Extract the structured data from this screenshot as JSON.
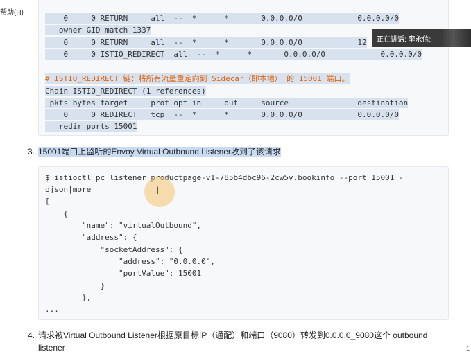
{
  "app": {
    "menu_help": "帮助(H)"
  },
  "speaker_overlay": {
    "text": "正在讲话: 李永信;"
  },
  "code_top": {
    "lines": [
      "    0     0 RETURN     all  --  *      *       0.0.0.0/0            0.0.0.0/0",
      "   owner GID match 1337",
      "    0     0 RETURN     all  --  *      *       0.0.0.0/0            12",
      "    0     0 ISTIO_REDIRECT  all  --  *      *       0.0.0.0/0            0.0.0.0/0",
      "",
      "# ISTIO_REDIRECT 链：将所有流量重定向到 Sidecar（即本地） 的 15001 端口。",
      "Chain ISTIO_REDIRECT (1 references)",
      " pkts bytes target     prot opt in     out     source               destination",
      "    0     0 REDIRECT   tcp  --  *      *       0.0.0.0/0            0.0.0.0/0",
      "   redir ports 15001"
    ]
  },
  "step3": {
    "number": "3.",
    "text": "15001端口上监听的Envoy Virtual Outbound Listener收到了该请求"
  },
  "code_bottom": {
    "lines": [
      "$ istioctl pc listener productpage-v1-785b4dbc96-2cw5v.bookinfo --port 15001 -",
      "ojson|more",
      "[",
      "    {",
      "        \"name\": \"virtualOutbound\",",
      "        \"address\": {",
      "            \"socketAddress\": {",
      "                \"address\": \"0.0.0.0\",",
      "                \"portValue\": 15001",
      "            }",
      "        },",
      "..."
    ]
  },
  "step4": {
    "number": "4.",
    "text_line1": "请求被Virtual Outbound Listener根据原目标IP（通配）和端口（9080）转发到0.0.0.0_9080这个 outbound",
    "text_line2": "listener"
  },
  "page_marker": "1"
}
